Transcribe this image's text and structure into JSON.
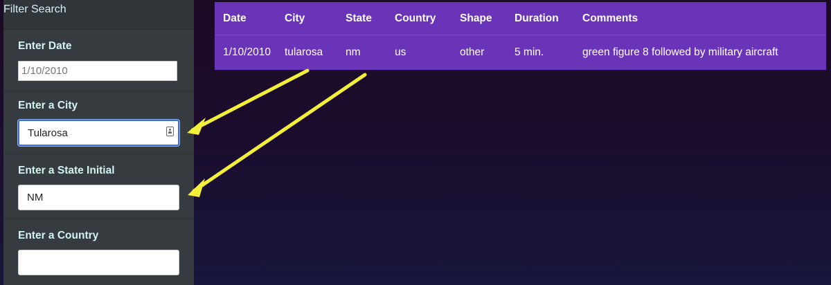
{
  "sidebar": {
    "title": "Filter Search",
    "fields": [
      {
        "label": "Enter Date",
        "value": "",
        "placeholder": "1/10/2010"
      },
      {
        "label": "Enter a City",
        "value": "Tularosa",
        "placeholder": ""
      },
      {
        "label": "Enter a State Initial",
        "value": "NM",
        "placeholder": ""
      },
      {
        "label": "Enter a Country",
        "value": "",
        "placeholder": ""
      }
    ]
  },
  "table": {
    "headers": [
      "Date",
      "City",
      "State",
      "Country",
      "Shape",
      "Duration",
      "Comments"
    ],
    "rows": [
      [
        "1/10/2010",
        "tularosa",
        "nm",
        "us",
        "other",
        "5 min.",
        "green figure 8 followed by military aircraft"
      ]
    ]
  },
  "colors": {
    "sidebar_bg": "#353b3f",
    "table_bg": "#6a34b8",
    "arrow": "#f4f03a",
    "focus_ring": "#3a6ed2"
  },
  "icons": [
    "contact-card-icon",
    "annotation-arrow"
  ]
}
